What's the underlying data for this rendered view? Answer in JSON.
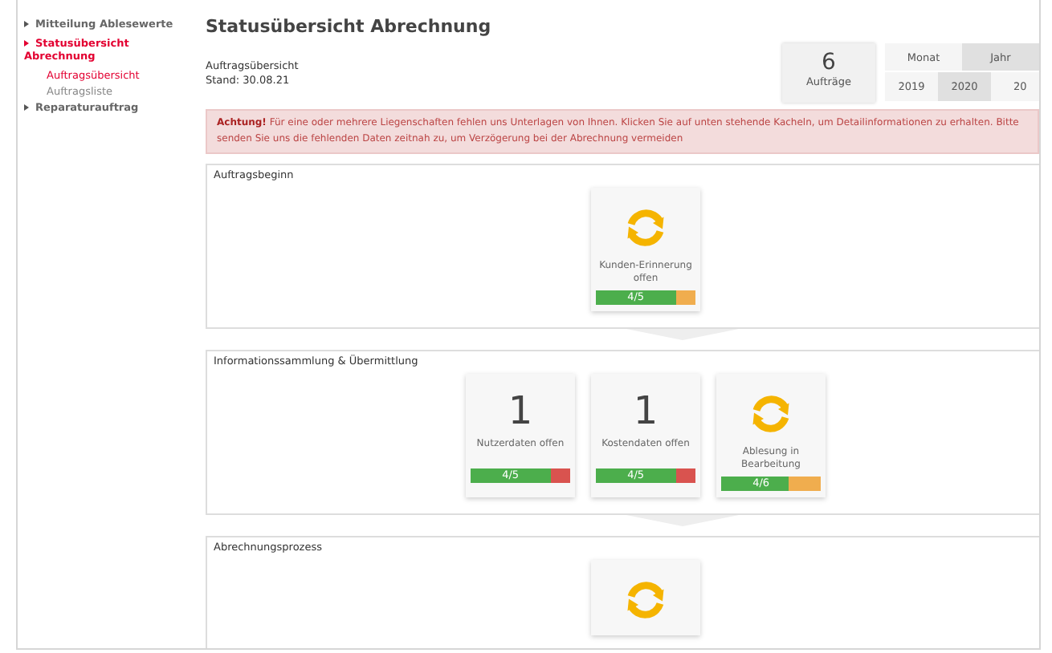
{
  "sidebar": {
    "items": [
      {
        "label": "Mitteilung Ablesewerte",
        "selected": false
      },
      {
        "label": "Statusübersicht Abrechnung",
        "selected": true,
        "children": [
          {
            "label": "Auftragsübersicht",
            "selected": true
          },
          {
            "label": "Auftragsliste",
            "selected": false
          }
        ]
      },
      {
        "label": "Reparaturauftrag",
        "selected": false
      }
    ]
  },
  "header": {
    "title": "Statusübersicht Abrechnung",
    "subtitle": "Auftragsübersicht",
    "date": "Stand: 30.08.21",
    "count": {
      "value": "6",
      "label": "Aufträge"
    },
    "period_tabs": [
      {
        "label": "Monat",
        "selected": false
      },
      {
        "label": "Jahr",
        "selected": true
      }
    ],
    "years": [
      {
        "label": "2019",
        "selected": false
      },
      {
        "label": "2020",
        "selected": true
      },
      {
        "label": "20",
        "selected": false
      }
    ]
  },
  "alert": {
    "text": "**Achtung!** Für eine oder mehrere Liegenschaften fehlen uns Unterlagen von Ihnen. Klicken Sie auf unten stehende Kacheln, um Detailinformationen zu erhalten. Bitte senden Sie uns die fehlenden Daten zeitnah zu, um Verzögerung bei der Abrechnung vermeiden"
  },
  "sections": [
    {
      "title": "Auftragsbeginn",
      "tiles": [
        {
          "kind": "spinner",
          "label": "Kunden-Erinnerung offen",
          "progress": "4/5",
          "level": 0.8,
          "color": "#f0ad4e"
        }
      ]
    },
    {
      "title": "Informationssammlung & Übermittlung",
      "tiles": [
        {
          "kind": "number",
          "value": "1",
          "label": "Nutzerdaten offen",
          "progress": "4/5",
          "level": 0.8,
          "color": "#d9534f"
        },
        {
          "kind": "number",
          "value": "1",
          "label": "Kostendaten offen",
          "progress": "4/5",
          "level": 0.8,
          "color": "#d9534f"
        },
        {
          "kind": "spinner",
          "label": "Ablesung in Bearbeitung",
          "progress": "4/6",
          "level": 0.67,
          "color": "#f0ad4e"
        }
      ]
    },
    {
      "title": "Abrechnungsprozess",
      "tiles": [
        {
          "kind": "spinner"
        }
      ]
    }
  ]
}
